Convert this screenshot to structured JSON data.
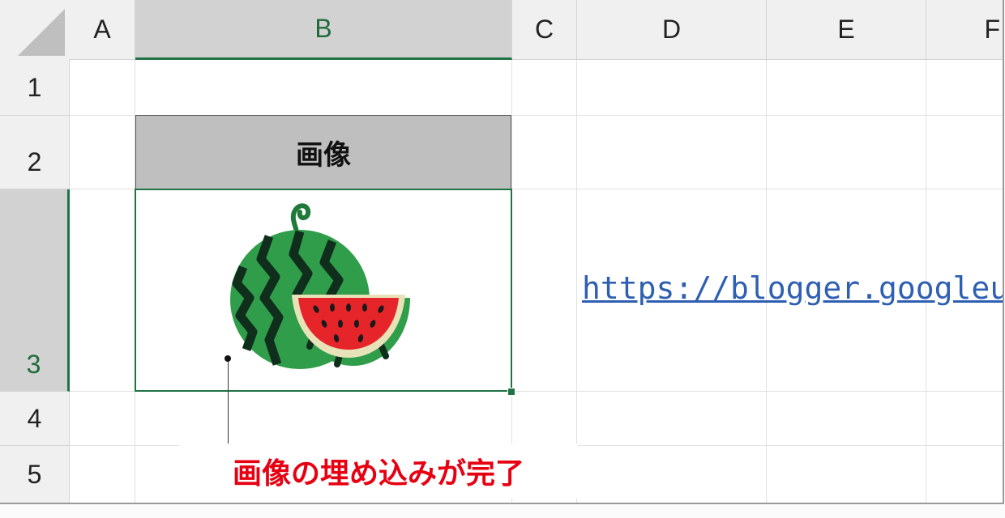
{
  "columns": [
    "A",
    "B",
    "C",
    "D",
    "E",
    "F"
  ],
  "rows": [
    "1",
    "2",
    "3",
    "4",
    "5"
  ],
  "cells": {
    "B2": "画像",
    "D3": "https://blogger.googleuser"
  },
  "image": {
    "icon": "watermelon-image"
  },
  "callout": {
    "text": "画像の埋め込みが完了"
  },
  "colors": {
    "selection_green": "#217346",
    "callout_red": "#e60012",
    "link_blue": "#2f5fb3"
  }
}
